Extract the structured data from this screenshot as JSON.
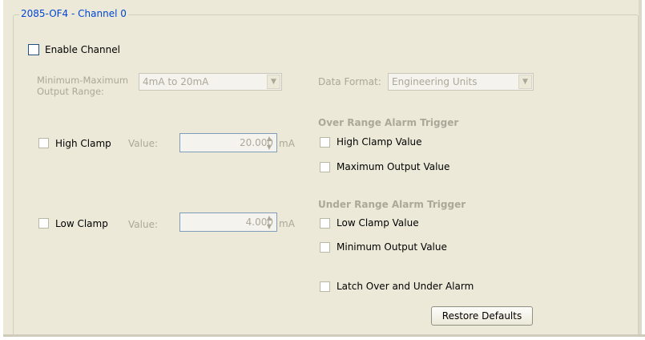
{
  "group": {
    "title": "2085-OF4 - Channel 0"
  },
  "enable_channel": {
    "label": "Enable Channel",
    "checked": false
  },
  "output_range": {
    "label_line1": "Minimum-Maximum",
    "label_line2": "Output Range:",
    "selected": "4mA to 20mA"
  },
  "data_format": {
    "label": "Data Format:",
    "selected": "Engineering Units"
  },
  "high_clamp": {
    "label": "High Clamp",
    "value_label": "Value:",
    "value": "20.000",
    "unit": "mA"
  },
  "low_clamp": {
    "label": "Low Clamp",
    "value_label": "Value:",
    "value": "4.000",
    "unit": "mA"
  },
  "over_range": {
    "header": "Over Range Alarm Trigger",
    "options": [
      "High Clamp Value",
      "Maximum Output Value"
    ]
  },
  "under_range": {
    "header": "Under Range Alarm Trigger",
    "options": [
      "Low Clamp Value",
      "Minimum Output Value"
    ]
  },
  "latch": {
    "label": "Latch Over and  Under Alarm"
  },
  "restore_button": {
    "label": "Restore Defaults"
  },
  "colors": {
    "panel": "#ece9d8",
    "title_blue": "#0046d5",
    "disabled_text": "#aca899"
  },
  "icons": {
    "dropdown": "chevron-down-icon",
    "spin_up": "spin-up-icon",
    "spin_down": "spin-down-icon"
  }
}
